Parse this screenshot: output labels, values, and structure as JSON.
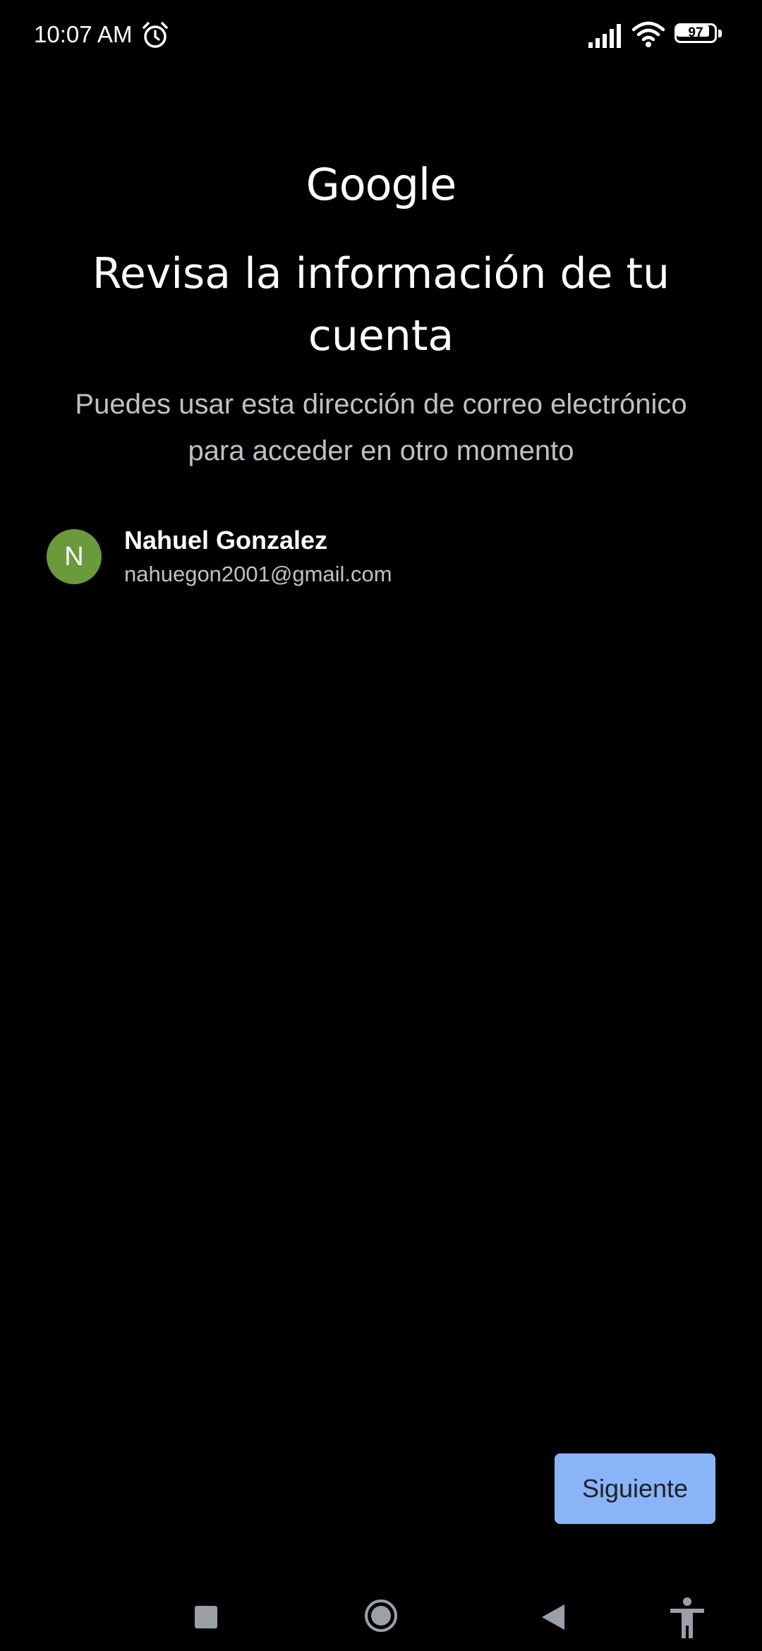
{
  "status_bar": {
    "time": "10:07 AM",
    "alarm_icon": "alarm-clock-icon",
    "signal_icon": "cell-signal-icon",
    "wifi_icon": "wifi-icon",
    "battery_level": "97"
  },
  "header": {
    "logo_text": "Google",
    "title": "Revisa la información de tu cuenta",
    "subtitle": "Puedes usar esta dirección de correo electrónico para acceder en otro momento"
  },
  "account": {
    "avatar_initial": "N",
    "avatar_color": "#6a9a3a",
    "name": "Nahuel Gonzalez",
    "email": "nahuegon2001@gmail.com"
  },
  "actions": {
    "next_label": "Siguiente",
    "next_color": "#8ab4f8"
  },
  "nav_bar": {
    "recents_icon": "square-recents-icon",
    "home_icon": "circle-home-icon",
    "back_icon": "triangle-back-icon",
    "accessibility_icon": "accessibility-person-icon"
  }
}
